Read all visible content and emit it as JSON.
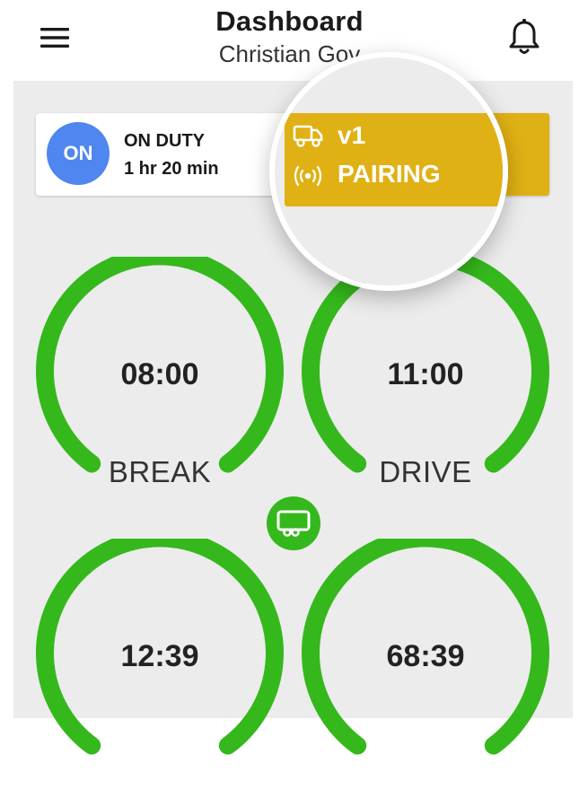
{
  "header": {
    "title": "Dashboard",
    "subtitle": "Christian Gov",
    "menu_icon": "hamburger-menu-icon",
    "notification_icon": "bell-icon"
  },
  "duty": {
    "badge": "ON",
    "status": "ON DUTY",
    "elapsed": "1 hr 20 min",
    "badge_color": "#4f86ef"
  },
  "vehicle": {
    "id": "v1",
    "connection_status": "PAIRING",
    "vehicle_icon": "truck-icon",
    "signal_icon": "broadcast-signal-icon",
    "panel_color": "#e0b114"
  },
  "gauges": [
    {
      "value": "08:00",
      "label": "BREAK"
    },
    {
      "value": "11:00",
      "label": "DRIVE"
    },
    {
      "value": "12:39",
      "label": ""
    },
    {
      "value": "68:39",
      "label": ""
    }
  ],
  "trailer_button": {
    "icon": "trailer-icon"
  },
  "colors": {
    "gauge_green": "#35b81c",
    "content_background": "#ececec"
  }
}
